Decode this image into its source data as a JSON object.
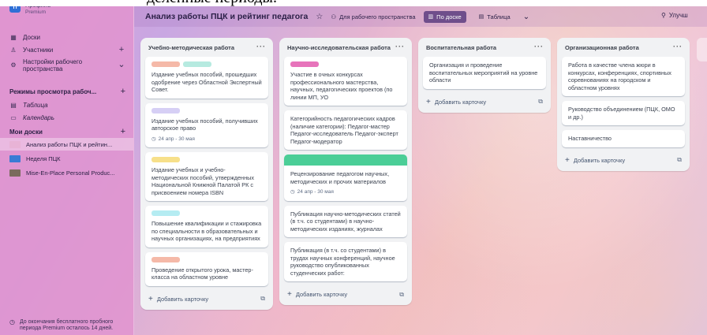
{
  "caption": "деленные периоды.",
  "workspace": {
    "logo": "П",
    "name": "Профиль",
    "plan": "Premium"
  },
  "sidebar": {
    "items": [
      {
        "icon": "board-icon",
        "glyph": "▦",
        "label": "Доски"
      },
      {
        "icon": "members-icon",
        "glyph": "♙",
        "label": "Участники",
        "action": "+"
      },
      {
        "icon": "settings-icon",
        "glyph": "⚙",
        "label": "Настройки рабочего пространства",
        "action": "⌄"
      }
    ],
    "views_section": {
      "title": "Режимы просмотра рабоч...",
      "action": "+"
    },
    "views": [
      {
        "icon": "table-icon",
        "glyph": "▤",
        "label": "Таблица"
      },
      {
        "icon": "calendar-icon",
        "glyph": "▭",
        "label": "Календарь"
      }
    ],
    "boards_section": {
      "title": "Мои доски",
      "action": "+"
    },
    "boards": [
      {
        "label": "Анализ работы ПЦК и рейтин...",
        "thumb": "#e8b3d6",
        "active": true
      },
      {
        "label": "Неделя ПЦК",
        "thumb": "#3a7bd5",
        "active": false
      },
      {
        "label": "Mise-En-Place Personal Produc...",
        "thumb": "#7a6b5d",
        "active": false
      }
    ],
    "trial": "До окончания бесплатного пробного периода Premium осталось 14 дней."
  },
  "header": {
    "title": "Анализ работы ПЦК и рейтинг педагога",
    "star_glyph": "☆",
    "visibility_glyph": "⚇",
    "visibility_label": "Для рабочего пространства",
    "views": [
      {
        "label": "По доске",
        "glyph": "▥",
        "active": true
      },
      {
        "label": "Таблица",
        "glyph": "▤",
        "active": false
      }
    ],
    "more_glyph": "⌄",
    "right_glyph": "⚲",
    "right_label": "Улучш"
  },
  "lists": [
    {
      "title": "Учебно-методическая работа",
      "cards": [
        {
          "labels": [
            "#f5b9a8",
            "#b6eae0"
          ],
          "text": "Издание учебных пособий, прошедших одобрение через Областной Экспертный Совет."
        },
        {
          "labels": [
            "#d6cff5"
          ],
          "text": "Издание учебных пособий, получивших авторское право",
          "date": "24 апр - 30 мая"
        },
        {
          "labels": [
            "#f7e08a"
          ],
          "text": "Издание учебных и учебно-методических пособий, утвержденных Национальной Книжной Палатой РК с присвоением номера ISBN"
        },
        {
          "labels": [
            "#b5ecf2"
          ],
          "text": "Повышение квалификации и стажировка по специальности в образовательных и научных организациях, на предприятиях"
        },
        {
          "labels": [
            "#f5b9a8"
          ],
          "text": "Проведение открытого урока, мастер-класса на областном уровне"
        }
      ],
      "add_label": "Добавить карточку"
    },
    {
      "title": "Научно-исследовательская работа",
      "cards": [
        {
          "labels": [
            "#e774bb"
          ],
          "text": "Участие в очных конкурсах профессионального мастерства, научных, педагогических проектов (по линии МП, УО"
        },
        {
          "labels": [],
          "text": "Категорийность педагогических кадров (наличие категории): Педагог-мастер Педагог-исследователь Педагог-эксперт Педагог-модератор"
        },
        {
          "cover": "#4bce97",
          "labels": [],
          "text": "Рецензирование педагогом научных, методических и прочих материалов",
          "date": "24 апр - 30 мая"
        },
        {
          "labels": [],
          "text": "Публикация научно-методических статей (в т.ч. со студентами) в научно-методических изданиях, журналах"
        },
        {
          "labels": [],
          "text": "Публикация (в т.ч. со студентами) в трудах научных конференций, научное руководство опубликованных студенческих работ:"
        }
      ],
      "add_label": "Добавить карточку"
    },
    {
      "title": "Воспитательная работа",
      "cards": [
        {
          "labels": [],
          "text": "Организация и проведение воспитательных мероприятий на уровне области"
        }
      ],
      "add_label": "Добавить карточку"
    },
    {
      "title": "Организационная работа",
      "cards": [
        {
          "labels": [],
          "text": "Работа в качестве члена жюри в конкурсах, конференциях, спортивных соревнованиях на городском и областном уровнях"
        },
        {
          "labels": [],
          "text": "Руководство объединением (ПЦК, ОМО и др.)"
        },
        {
          "labels": [],
          "text": "Наставничество"
        }
      ],
      "add_label": "Добавить карточку"
    }
  ]
}
